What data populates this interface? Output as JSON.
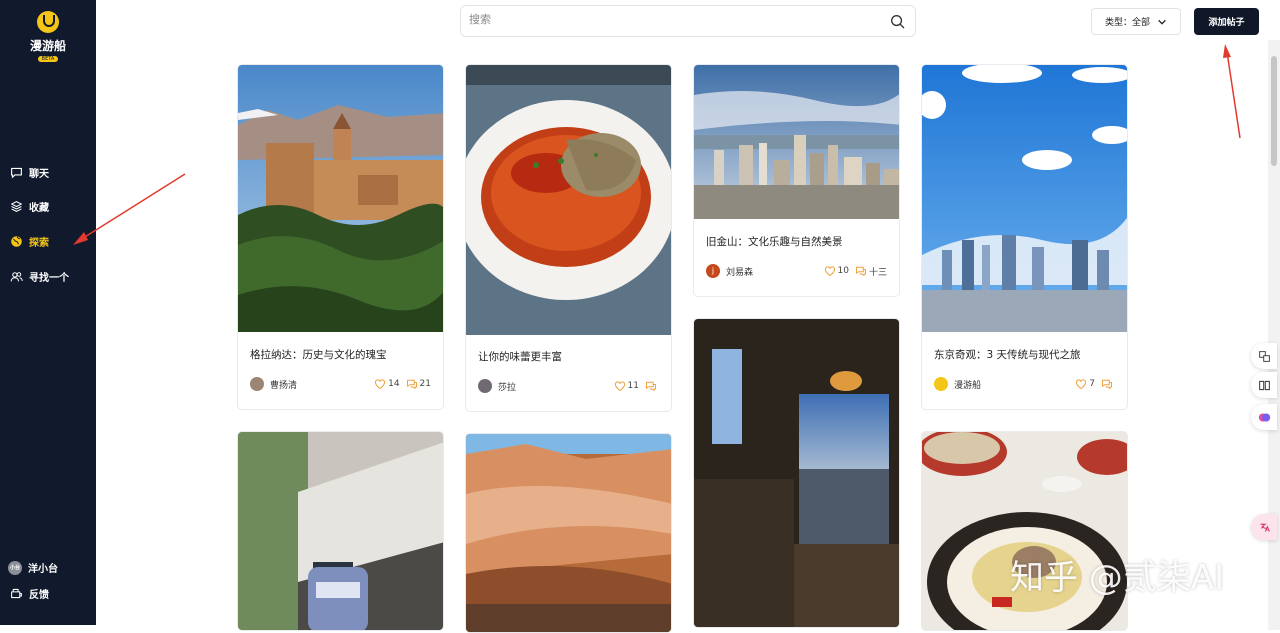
{
  "app": {
    "name": "漫游船",
    "badge": "BETA"
  },
  "sidebar": {
    "items": [
      {
        "label": "聊天",
        "icon": "chat-icon"
      },
      {
        "label": "收藏",
        "icon": "layers-icon"
      },
      {
        "label": "探索",
        "icon": "globe-icon",
        "active": true
      },
      {
        "label": "寻找一个",
        "icon": "users-icon"
      }
    ],
    "user": {
      "name": "洋小台",
      "avatar_text": "小台"
    },
    "feedback_label": "反馈"
  },
  "header": {
    "search_placeholder": "搜索",
    "filter_label": "类型：全部",
    "add_button": "添加帖子"
  },
  "posts": [
    {
      "title": "格拉纳达：历史与文化的瑰宝",
      "author": "曹扬清",
      "likes": "14",
      "comments": "21"
    },
    {
      "title": "让你的味蕾更丰富",
      "author": "莎拉",
      "likes": "11",
      "comments": ""
    },
    {
      "title": "旧金山：文化乐趣与自然美景",
      "author": "刘易森",
      "author_initial": "j",
      "likes": "10",
      "comments": "十三"
    },
    {
      "title": "东京奇观：3 天传统与现代之旅",
      "author": "漫游船",
      "likes": "7",
      "comments": ""
    }
  ],
  "watermark": "知乎 @贰柒AI",
  "colors": {
    "sidebar_bg": "#101a2c",
    "accent": "#f5c518",
    "button_bg": "#0f1728",
    "arrow": "#e23a2e",
    "like": "#f0a13c"
  }
}
